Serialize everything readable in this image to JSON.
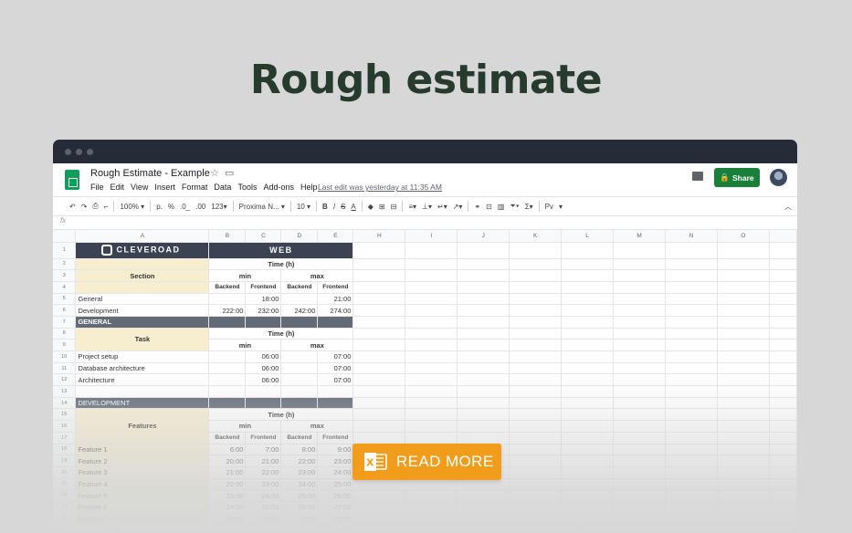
{
  "headline": "Rough estimate",
  "app": {
    "doc_title": "Rough Estimate - Example",
    "menu": [
      "File",
      "Edit",
      "View",
      "Insert",
      "Format",
      "Data",
      "Tools",
      "Add-ons",
      "Help"
    ],
    "last_edit": "Last edit was yesterday at 11:35 AM",
    "share_label": "Share"
  },
  "toolbar": {
    "zoom": "100%",
    "format_p": "p.",
    "format_pct": "%",
    "dec_less": ".0_",
    "dec_more": ".00",
    "more_formats": "123",
    "font": "Proxima N...",
    "font_size": "10",
    "bold": "B",
    "italic": "I",
    "strike": "S",
    "textcolor": "A",
    "lang": "Pv"
  },
  "formula": {
    "fx": "fx",
    "value": ""
  },
  "columns": [
    "A",
    "B",
    "C",
    "D",
    "E",
    "",
    "H",
    "I",
    "J",
    "K",
    "L",
    "M",
    "N",
    "O"
  ],
  "sheet": {
    "brand": "CLEVEROAD",
    "web": "WEB",
    "time_h": "Time (h)",
    "section": "Section",
    "min": "min",
    "max": "max",
    "backend": "Backend",
    "frontend": "Frontend",
    "general": "General",
    "development": "Development",
    "general_bar": "GENERAL",
    "development_bar": "DEVELOPMENT",
    "task": "Task",
    "features": "Features",
    "summary": [
      {
        "name": "General",
        "b": "",
        "c": "18:00",
        "d": "",
        "e": "21:00"
      },
      {
        "name": "Development",
        "b": "222:00",
        "c": "232:00",
        "d": "242:00",
        "e": "274:00"
      }
    ],
    "tasks": [
      {
        "name": "Project setup",
        "c": "06:00",
        "e": "07:00"
      },
      {
        "name": "Database architecture",
        "c": "06:00",
        "e": "07:00"
      },
      {
        "name": "Architecture",
        "c": "06:00",
        "e": "07:00"
      }
    ],
    "features_rows": [
      {
        "name": "Feature 1",
        "b": "6:00",
        "c": "7:00",
        "d": "8:00",
        "e": "9:00"
      },
      {
        "name": "Feature 2",
        "b": "20:00",
        "c": "21:00",
        "d": "22:00",
        "e": "23:00"
      },
      {
        "name": "Feature 3",
        "b": "21:00",
        "c": "22:00",
        "d": "23:00",
        "e": "24:00"
      },
      {
        "name": "Feature 4",
        "b": "22:00",
        "c": "23:00",
        "d": "24:00",
        "e": "25:00"
      },
      {
        "name": "Feature 5",
        "b": "23:00",
        "c": "24:00",
        "d": "25:00",
        "e": "26:00"
      },
      {
        "name": "Feature 6",
        "b": "24:00",
        "c": "25:00",
        "d": "26:00",
        "e": "27:00"
      },
      {
        "name": "Feature 7",
        "b": "25:00",
        "c": "26:00",
        "d": "27:00",
        "e": "28:00"
      }
    ]
  },
  "cta": {
    "label": "READ MORE"
  },
  "colors": {
    "accent": "#f29c1c",
    "share": "#188038",
    "headline": "#263a2e",
    "section_fill": "#f7eed0",
    "bar": "#646b77"
  }
}
